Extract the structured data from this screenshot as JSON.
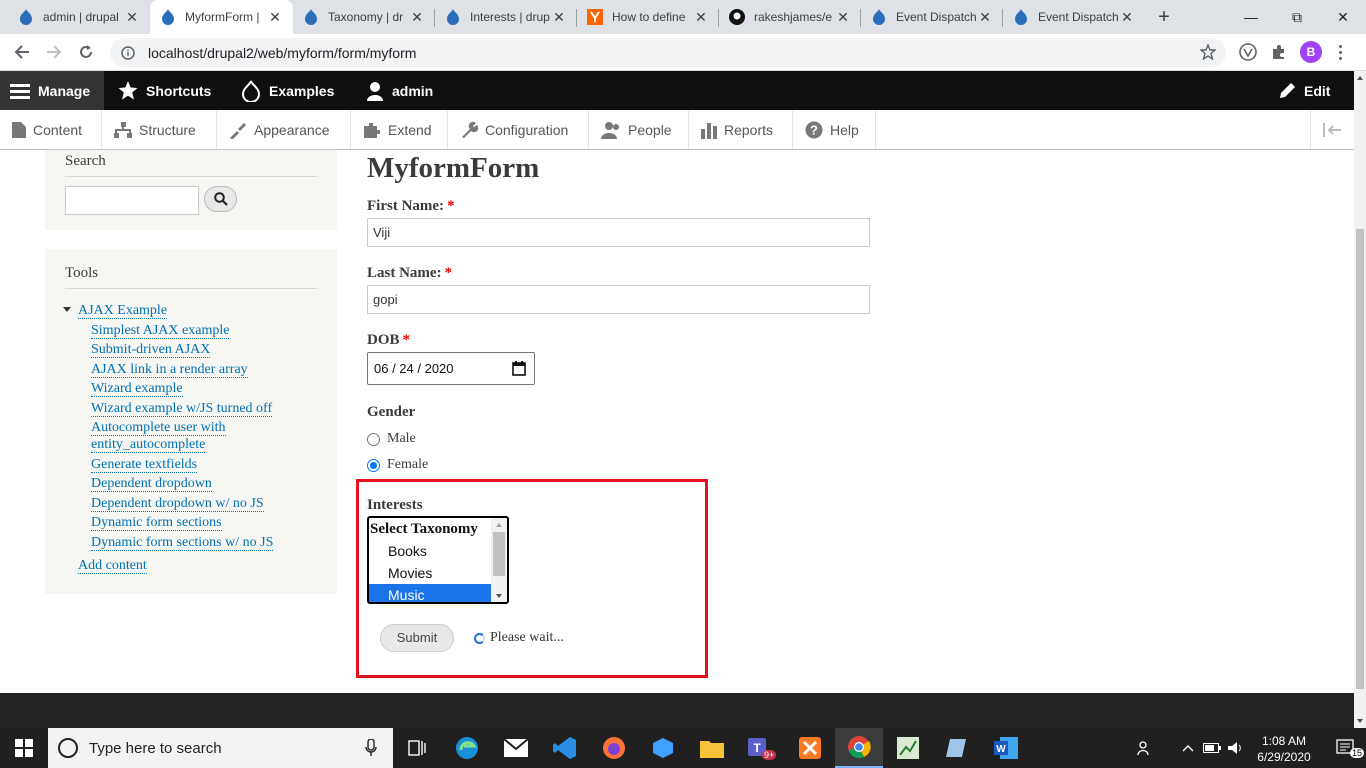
{
  "browser": {
    "tabs": [
      {
        "title": "admin | drupal",
        "icon": "drupal-icon",
        "active": false
      },
      {
        "title": "MyformForm | ",
        "icon": "drupal-icon",
        "active": true
      },
      {
        "title": "Taxonomy | dr",
        "icon": "drupal-icon",
        "active": false
      },
      {
        "title": "Interests | drup",
        "icon": "drupal-icon",
        "active": false
      },
      {
        "title": "How to define",
        "icon": "y-combinator-icon",
        "active": false
      },
      {
        "title": "rakeshjames/e",
        "icon": "github-icon",
        "active": false
      },
      {
        "title": "Event Dispatch",
        "icon": "drupal-icon",
        "active": false
      },
      {
        "title": "Event Dispatch",
        "icon": "drupal-icon",
        "active": false
      }
    ],
    "url": "localhost/drupal2/web/myform/form/myform",
    "profile_initial": "B"
  },
  "admin_toolbar": {
    "manage": "Manage",
    "shortcuts": "Shortcuts",
    "examples": "Examples",
    "user": "admin",
    "edit": "Edit"
  },
  "tray": {
    "items": [
      "Content",
      "Structure",
      "Appearance",
      "Extend",
      "Configuration",
      "People",
      "Reports",
      "Help"
    ]
  },
  "sidebar": {
    "search_title": "Search",
    "tools_title": "Tools",
    "tools_parent": "AJAX Example",
    "tools_children": [
      "Simplest AJAX example",
      "Submit-driven AJAX",
      "AJAX link in a render array",
      "Wizard example",
      "Wizard example w/JS turned off",
      "Autocomplete user with",
      "entity_autocomplete",
      "Generate textfields",
      "Dependent dropdown",
      "Dependent dropdown w/ no JS",
      "Dynamic form sections",
      "Dynamic form sections w/ no JS"
    ],
    "add_content": "Add content"
  },
  "form": {
    "title": "MyformForm",
    "first_name_label": "First Name:",
    "first_name_value": "Viji",
    "last_name_label": "Last Name:",
    "last_name_value": "gopi",
    "dob_label": "DOB",
    "dob_value": "06 / 24 / 2020",
    "gender_label": "Gender",
    "gender_options": [
      "Male",
      "Female"
    ],
    "gender_selected": "Female",
    "interests_label": "Interests",
    "interests_options": [
      "Select Taxonomy",
      "Books",
      "Movies",
      "Music"
    ],
    "interests_selected": "Music",
    "submit": "Submit",
    "wait_text": "Please wait...",
    "required_mark": "*"
  },
  "taskbar": {
    "search_placeholder": "Type here to search",
    "time": "1:08 AM",
    "date": "6/29/2020",
    "notification_count": "15",
    "teams_badge": "9+"
  },
  "colors": {
    "highlight_box": "#e3101e",
    "drupal_link": "#0071b3",
    "selected_option": "#1a73e8"
  }
}
